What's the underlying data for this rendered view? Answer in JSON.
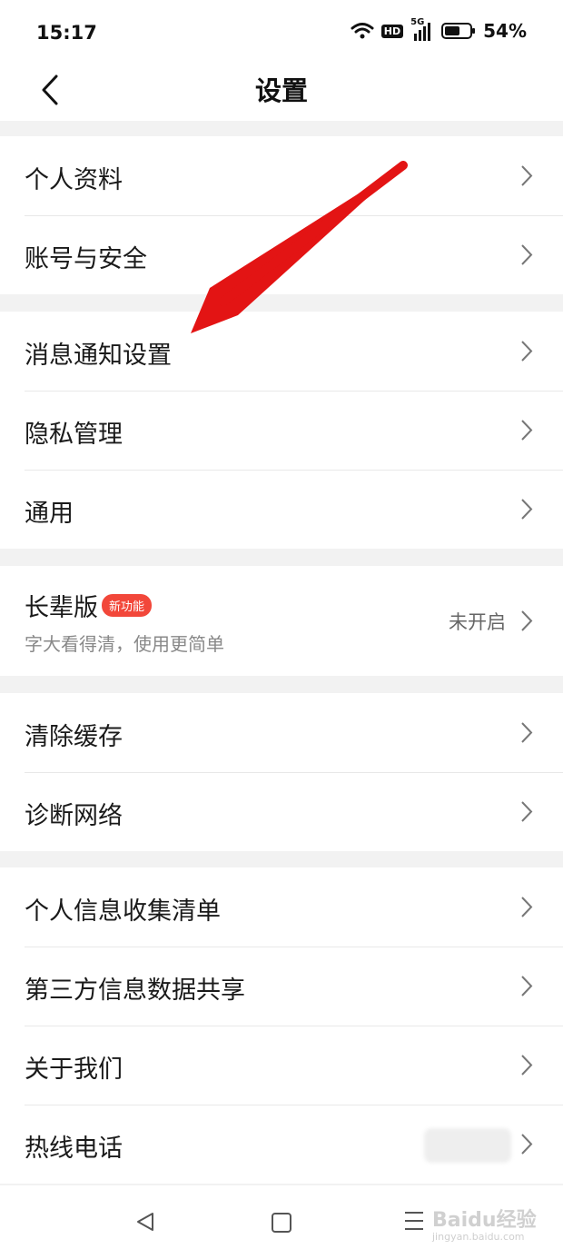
{
  "status_bar": {
    "time": "15:17",
    "network": "5G",
    "hd": "HD",
    "battery": "54%"
  },
  "header": {
    "title": "设置"
  },
  "groups": [
    {
      "items": [
        {
          "label": "个人资料"
        },
        {
          "label": "账号与安全"
        }
      ]
    },
    {
      "items": [
        {
          "label": "消息通知设置"
        },
        {
          "label": "隐私管理"
        },
        {
          "label": "通用"
        }
      ]
    },
    {
      "items": [
        {
          "label": "长辈版",
          "badge": "新功能",
          "subtitle": "字大看得清，使用更简单",
          "value": "未开启"
        }
      ]
    },
    {
      "items": [
        {
          "label": "清除缓存"
        },
        {
          "label": "诊断网络"
        }
      ]
    },
    {
      "items": [
        {
          "label": "个人信息收集清单"
        },
        {
          "label": "第三方信息数据共享"
        },
        {
          "label": "关于我们"
        },
        {
          "label": "热线电话"
        }
      ]
    }
  ],
  "watermark": {
    "text": "Baidu经验",
    "sub": "jingyan.baidu.com"
  },
  "colors": {
    "badge": "#f2473a",
    "arrow": "#e31414"
  }
}
